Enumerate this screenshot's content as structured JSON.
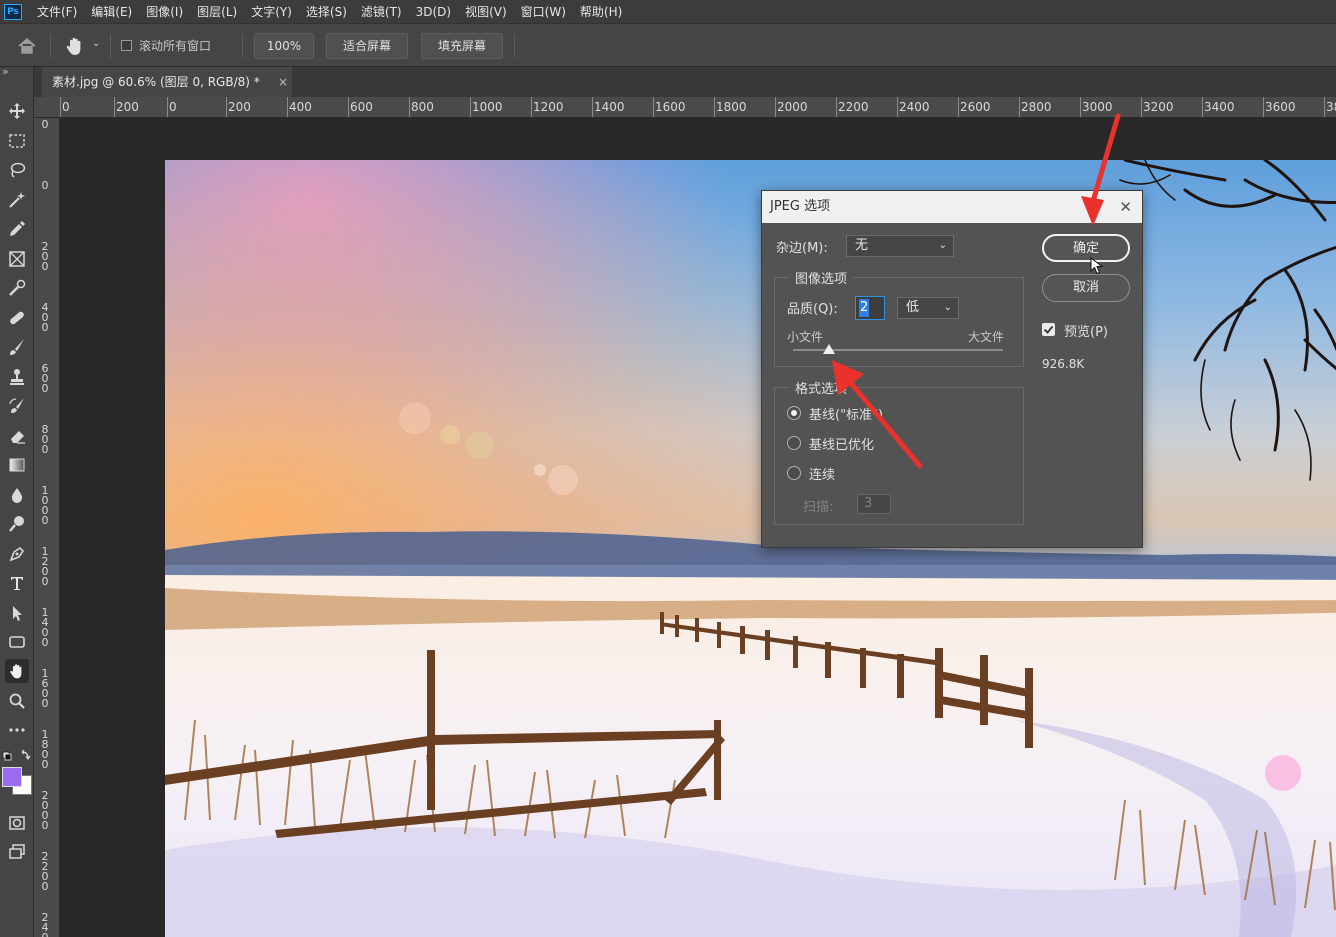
{
  "app": {
    "logo": "Ps"
  },
  "menu": [
    "文件(F)",
    "编辑(E)",
    "图像(I)",
    "图层(L)",
    "文字(Y)",
    "选择(S)",
    "滤镜(T)",
    "3D(D)",
    "视图(V)",
    "窗口(W)",
    "帮助(H)"
  ],
  "options": {
    "scroll_all_label": "滚动所有窗口",
    "zoom_value": "100%",
    "fit_screen_label": "适合屏幕",
    "fill_screen_label": "填充屏幕"
  },
  "tab": {
    "title": "素材.jpg @ 60.6% (图层 0, RGB/8) *",
    "close": "×"
  },
  "panel_toggle": "»",
  "ruler_top_labels": [
    "0",
    "200",
    "0",
    "200",
    "400",
    "600",
    "800",
    "1000",
    "1200",
    "1400",
    "1600",
    "1800",
    "2000",
    "2200",
    "2400",
    "2600",
    "2800",
    "3000",
    "3200",
    "3400",
    "3600",
    "38"
  ],
  "ruler_left_labels": [
    "0",
    "0",
    "200",
    "400",
    "600",
    "800",
    "1000",
    "1200",
    "1400",
    "1600",
    "1800",
    "2000",
    "2200",
    "2400"
  ],
  "tools": [
    "move-icon",
    "marquee-icon",
    "lasso-icon",
    "magic-wand-icon",
    "eyedropper-icon",
    "frame-icon",
    "spot-heal-icon",
    "bandage-icon",
    "brush-icon",
    "stamp-icon",
    "history-brush-icon",
    "eraser-icon",
    "gradient-icon",
    "blur-icon",
    "dodge-icon",
    "pen-icon",
    "type-icon",
    "path-select-icon",
    "rectangle-icon",
    "hand-icon",
    "zoom-icon",
    "more-icon"
  ],
  "colors": {
    "foreground": "#9c6cf0",
    "background": "#ffffff",
    "accent": "#31a8ff",
    "arrow": "#e8322b"
  },
  "dialog": {
    "title": "JPEG 选项",
    "close": "✕",
    "matte_label": "杂边(M):",
    "matte_value": "无",
    "image_options_legend": "图像选项",
    "quality_label": "品质(Q):",
    "quality_value": "2",
    "quality_preset": "低",
    "small_file": "小文件",
    "large_file": "大文件",
    "quality_slider": 0.17,
    "format_legend": "格式选项",
    "format_options": [
      "基线(\"标准\")",
      "基线已优化",
      "连续"
    ],
    "format_selected": 0,
    "scans_label": "扫描:",
    "scans_value": "3",
    "ok_label": "确定",
    "cancel_label": "取消",
    "preview_label": "预览(P)",
    "preview_checked": true,
    "file_size": "926.8K"
  }
}
